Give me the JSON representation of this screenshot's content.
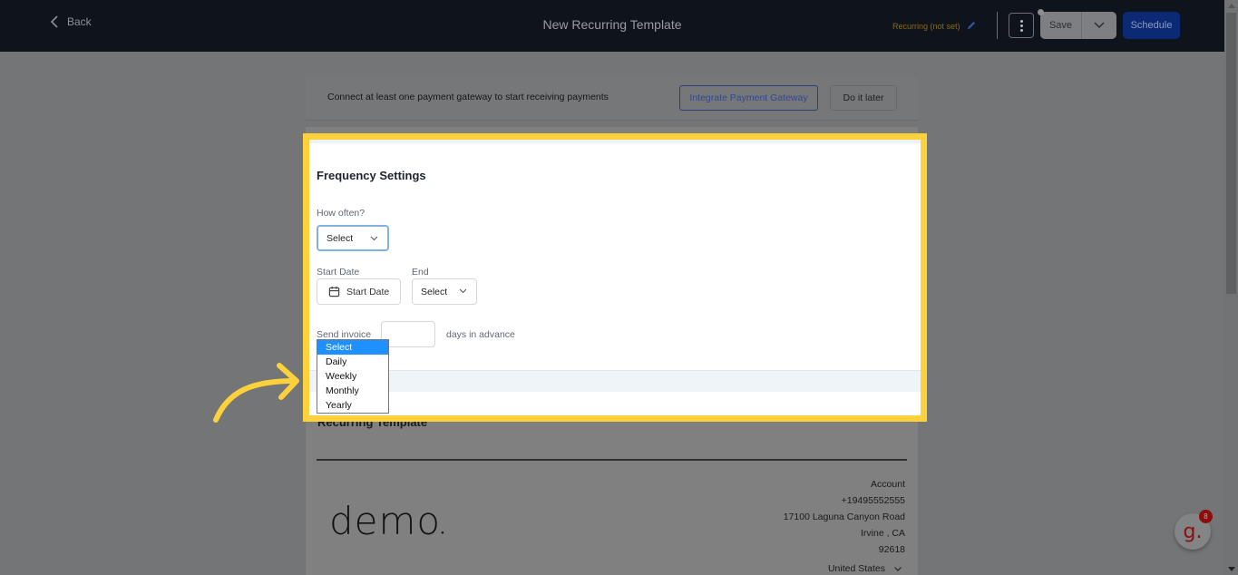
{
  "header": {
    "back_label": "Back",
    "title": "New Recurring Template",
    "recurring_status": "Recurring (not set)",
    "save_label": "Save",
    "schedule_label": "Schedule"
  },
  "banner": {
    "message": "Connect at least one payment gateway to start receiving payments",
    "integrate_label": "Integrate Payment Gateway",
    "later_label": "Do it later"
  },
  "frequency": {
    "title": "Frequency Settings",
    "how_often_label": "How often?",
    "how_often_value": "Select",
    "start_date_label": "Start Date",
    "start_date_button": "Start Date",
    "end_label": "End",
    "end_value": "Select",
    "send_invoice_label": "Send invoice",
    "days_value": "",
    "days_suffix": "days in advance",
    "options": [
      "Select",
      "Daily",
      "Weekly",
      "Monthly",
      "Yearly"
    ],
    "selected_option": "Select"
  },
  "document": {
    "title": "Recurring Template",
    "logo_text": "demo",
    "address": {
      "name": "Account",
      "phone": "+19495552555",
      "street": "17100 Laguna Canyon Road",
      "city_state": "Irvine , CA",
      "zip": "92618",
      "country": "United States"
    }
  },
  "help_widget": {
    "glyph": "g.",
    "badge_count": "8"
  },
  "colors": {
    "highlight": "#fcd13c",
    "schedule_button": "#0c2a73",
    "dropdown_selected": "#1e90ff"
  }
}
